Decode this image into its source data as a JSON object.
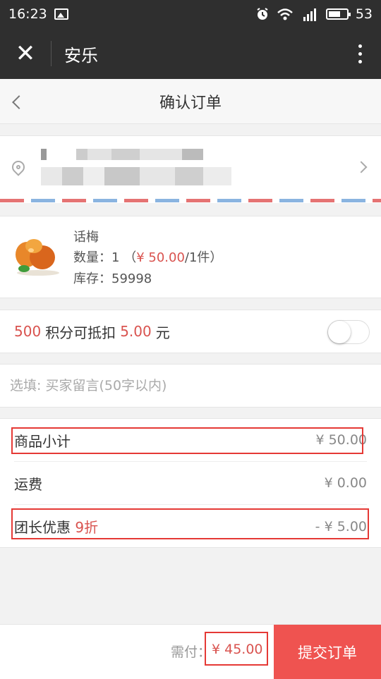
{
  "status_bar": {
    "time": "16:23",
    "battery": "53"
  },
  "app_bar": {
    "close_glyph": "✕",
    "title": "安乐"
  },
  "page_header": {
    "title": "确认订单"
  },
  "product": {
    "name": "话梅",
    "qty_label": "数量：",
    "qty": "1",
    "price_open": "（",
    "price": "¥ 50.00",
    "unit": "/1件）",
    "stock_label": "库存：",
    "stock": "59998"
  },
  "points": {
    "amount": "500",
    "text": "积分可抵扣",
    "deduct": "5.00",
    "unit": "元",
    "enabled": false
  },
  "message": {
    "placeholder": "选填: 买家留言(50字以内)"
  },
  "summary": {
    "subtotal_label": "商品小计",
    "subtotal": "¥ 50.00",
    "shipping_label": "运费",
    "shipping": "¥ 0.00",
    "discount_label": "团长优惠",
    "discount_rate": "9折",
    "discount": "- ¥ 5.00"
  },
  "footer": {
    "due_label": "需付：",
    "due": "¥ 45.00",
    "submit": "提交订单"
  },
  "colors": {
    "accent": "#d9534f",
    "submit_bg": "#ef5350",
    "highlight": "#e53935",
    "bar_bg": "#2f2f2f"
  }
}
